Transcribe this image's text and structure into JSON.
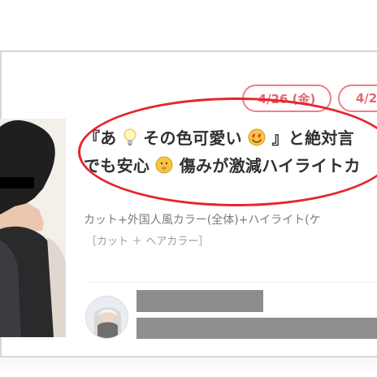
{
  "listing": {
    "dates": [
      "4/26 (金)",
      "4/2"
    ],
    "title": {
      "line1_part1": "『あ",
      "line1_part2": "その色可愛い",
      "line1_part3": "』と絶対言",
      "line2_part1": "でも安心",
      "line2_part2": "傷みが激減ハイライトカ"
    },
    "subtitle": "カット+外国人風カラー(全体)+ハイライト(ケ",
    "tags": "［カット ＋ ヘアカラー］"
  },
  "colors": {
    "accent_pink": "#ef7f86",
    "highlight_red": "#e4262d"
  },
  "icons": [
    "lightbulb-icon",
    "heart-eyes-emoji-icon",
    "shushing-face-emoji-icon"
  ]
}
